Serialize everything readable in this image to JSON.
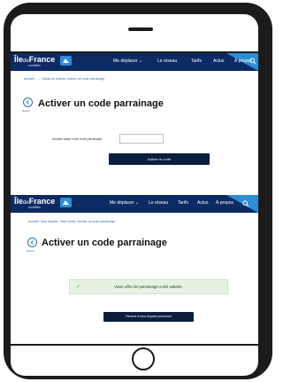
{
  "brand": {
    "name_part1": "Île",
    "name_part2": "de",
    "name_part3": "France",
    "sub": "mobilités"
  },
  "nav": {
    "items": [
      "Me déplacer ⌄",
      "Le réseau",
      "Tarifs",
      "Actus",
      "À propos"
    ],
    "search_icon": "search-icon"
  },
  "screen_top": {
    "breadcrumb": "Accueil  ›  …  ›  Détail du contrat  ›  Activer un code parrainage",
    "back_label": "Retour",
    "title": "Activer un code parrainage",
    "field_label": "Veuillez saisir votre code parrainage",
    "field_value": "",
    "submit_label": "Activer le code"
  },
  "screen_bottom": {
    "breadcrumb": "Accueil  ›  Mon espace  ›  Mon forfait  ›  Activer un code parrainage",
    "back_label": "Retour",
    "title": "Activer un code parrainage",
    "success_message": "Votre offre de parrainage a été validée.",
    "return_label": "Revenir à mon espace personnel"
  },
  "colors": {
    "nav_bg": "#0c2a63",
    "accent": "#2c8fd6",
    "button_dark": "#0b1e3d",
    "success_bg": "#e6f3e2",
    "success_check": "#3c9a2e"
  }
}
